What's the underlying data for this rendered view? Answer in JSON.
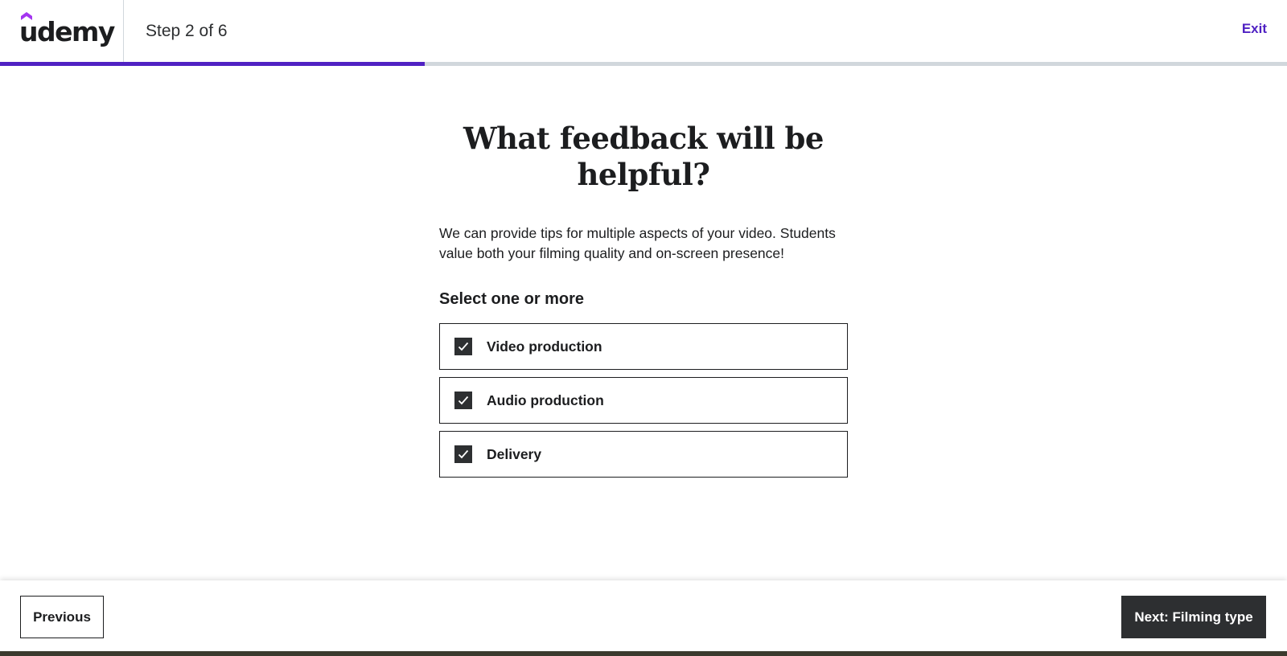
{
  "header": {
    "logo_text": "udemy",
    "step_text": "Step 2 of 6",
    "exit_label": "Exit",
    "progress_fraction": 0.33
  },
  "main": {
    "title": "What feedback will be helpful?",
    "description": "We can provide tips for multiple aspects of your video. Students value both your filming quality and on-screen presence!",
    "select_label": "Select one or more",
    "options": [
      {
        "label": "Video production",
        "checked": true
      },
      {
        "label": "Audio production",
        "checked": true
      },
      {
        "label": "Delivery",
        "checked": true
      }
    ]
  },
  "footer": {
    "previous_label": "Previous",
    "next_label": "Next: Filming type"
  },
  "colors": {
    "accent": "#5022c3",
    "dark": "#2d2f31",
    "text": "#1c1d1f",
    "track": "#d1d7dc"
  }
}
